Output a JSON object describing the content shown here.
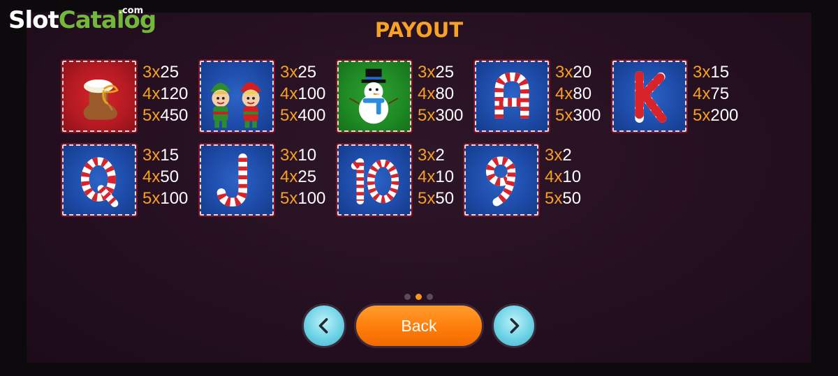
{
  "branding": {
    "logo_slot": "Slot",
    "logo_catalog": "Catalog",
    "logo_com": ".com"
  },
  "title": "PAYOUT",
  "symbols": [
    {
      "name": "boot",
      "pays": [
        [
          "3x",
          "25"
        ],
        [
          "4x",
          "120"
        ],
        [
          "5x",
          "450"
        ]
      ]
    },
    {
      "name": "elves",
      "pays": [
        [
          "3x",
          "25"
        ],
        [
          "4x",
          "100"
        ],
        [
          "5x",
          "400"
        ]
      ]
    },
    {
      "name": "snowman",
      "pays": [
        [
          "3x",
          "25"
        ],
        [
          "4x",
          "80"
        ],
        [
          "5x",
          "300"
        ]
      ]
    },
    {
      "name": "A",
      "letter": "A",
      "pays": [
        [
          "3x",
          "20"
        ],
        [
          "4x",
          "80"
        ],
        [
          "5x",
          "300"
        ]
      ]
    },
    {
      "name": "K",
      "letter": "K",
      "pays": [
        [
          "3x",
          "15"
        ],
        [
          "4x",
          "75"
        ],
        [
          "5x",
          "200"
        ]
      ]
    },
    {
      "name": "Q",
      "letter": "Q",
      "pays": [
        [
          "3x",
          "15"
        ],
        [
          "4x",
          "50"
        ],
        [
          "5x",
          "100"
        ]
      ]
    },
    {
      "name": "J",
      "letter": "J",
      "pays": [
        [
          "3x",
          "10"
        ],
        [
          "4x",
          "25"
        ],
        [
          "5x",
          "100"
        ]
      ]
    },
    {
      "name": "10",
      "letter": "10",
      "pays": [
        [
          "3x",
          "2"
        ],
        [
          "4x",
          "10"
        ],
        [
          "5x",
          "50"
        ]
      ]
    },
    {
      "name": "9",
      "letter": "9",
      "pays": [
        [
          "3x",
          "2"
        ],
        [
          "4x",
          "10"
        ],
        [
          "5x",
          "50"
        ]
      ]
    }
  ],
  "pagination": {
    "pages": 3,
    "current": 2
  },
  "buttons": {
    "back_label": "Back",
    "prev_icon": "chevron-left-icon",
    "next_icon": "chevron-right-icon"
  },
  "colors": {
    "multiplier": "#f5a023",
    "value": "#ffffff",
    "title": "#f7a226",
    "back": "#ff7d0a"
  }
}
